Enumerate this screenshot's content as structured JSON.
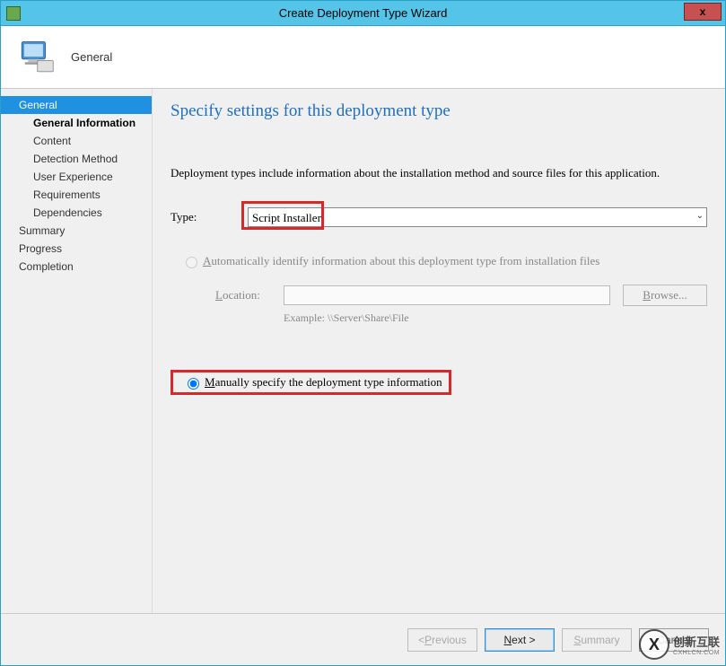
{
  "window": {
    "title": "Create Deployment Type Wizard",
    "close_glyph": "x"
  },
  "header": {
    "title": "General"
  },
  "sidebar": {
    "items": [
      {
        "label": "General",
        "level": 1,
        "active": true
      },
      {
        "label": "General Information",
        "level": 2,
        "active_sub": true
      },
      {
        "label": "Content",
        "level": 2
      },
      {
        "label": "Detection Method",
        "level": 2
      },
      {
        "label": "User Experience",
        "level": 2
      },
      {
        "label": "Requirements",
        "level": 2
      },
      {
        "label": "Dependencies",
        "level": 2
      },
      {
        "label": "Summary",
        "level": 1
      },
      {
        "label": "Progress",
        "level": 1
      },
      {
        "label": "Completion",
        "level": 1
      }
    ]
  },
  "content": {
    "heading": "Specify settings for this deployment type",
    "description": "Deployment types include information about the installation method and source files for this application.",
    "type_label": "Type:",
    "type_value": "Script Installer",
    "auto_label_prefix": "A",
    "auto_label_rest": "utomatically identify information about this deployment type from installation files",
    "location_label_prefix": "L",
    "location_label_rest": "ocation:",
    "browse_label_prefix": "B",
    "browse_label_rest": "rowse...",
    "example_label": "Example: \\\\Server\\Share\\File",
    "manual_label_prefix": "M",
    "manual_label_rest": "anually specify the deployment type information",
    "selected_option": "manual"
  },
  "footer": {
    "previous_prefix": "< ",
    "previous_under": "P",
    "previous_rest": "revious",
    "next_under": "N",
    "next_rest": "ext >",
    "summary_under": "S",
    "summary_rest": "ummary",
    "cancel": "Cancel"
  },
  "watermark": {
    "glyph": "X",
    "text": "创新互联",
    "sub": "CXHLCN.COM"
  }
}
